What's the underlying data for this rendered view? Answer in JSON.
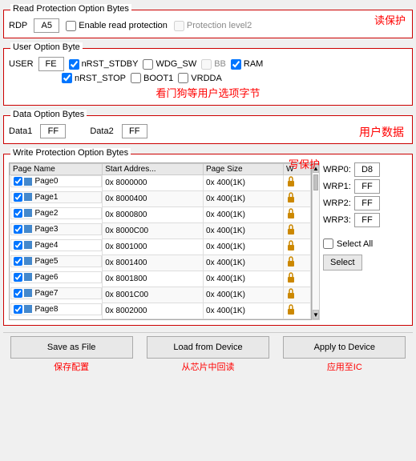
{
  "readProtection": {
    "title": "Read Protection Option Bytes",
    "annotation": "读保护",
    "rdpLabel": "RDP",
    "rdpValue": "A5",
    "enableReadProtection": "Enable read protection",
    "protectionLevel2": "Protection level2",
    "enableChecked": false,
    "level2Checked": false
  },
  "userOption": {
    "title": "User Option Byte",
    "annotation": "看门狗等用户选项字节",
    "userLabel": "USER",
    "userValue": "FE",
    "options": [
      {
        "label": "nRST_STDBY",
        "checked": true
      },
      {
        "label": "WDG_SW",
        "checked": false
      },
      {
        "label": "BB",
        "checked": false
      },
      {
        "label": "RAM",
        "checked": true
      }
    ],
    "row2Options": [
      {
        "label": "nRST_STOP",
        "checked": true
      },
      {
        "label": "BOOT1",
        "checked": false
      },
      {
        "label": "VRDDA",
        "checked": false
      }
    ]
  },
  "dataOption": {
    "title": "Data Option Bytes",
    "annotation": "用户数据",
    "data1Label": "Data1",
    "data1Value": "FF",
    "data2Label": "Data2",
    "data2Value": "FF"
  },
  "writeProtection": {
    "title": "Write Protection Option Bytes",
    "annotation": "写保护",
    "tableHeaders": [
      "Page Name",
      "Start Addres...",
      "Page Size",
      "W"
    ],
    "pages": [
      {
        "name": "Page0",
        "start": "0x 8000000",
        "size": "0x 400(1K)",
        "checked": true
      },
      {
        "name": "Page1",
        "start": "0x 8000400",
        "size": "0x 400(1K)",
        "checked": true
      },
      {
        "name": "Page2",
        "start": "0x 8000800",
        "size": "0x 400(1K)",
        "checked": true
      },
      {
        "name": "Page3",
        "start": "0x 8000C00",
        "size": "0x 400(1K)",
        "checked": true
      },
      {
        "name": "Page4",
        "start": "0x 8001000",
        "size": "0x 400(1K)",
        "checked": true
      },
      {
        "name": "Page5",
        "start": "0x 8001400",
        "size": "0x 400(1K)",
        "checked": true
      },
      {
        "name": "Page6",
        "start": "0x 8001800",
        "size": "0x 400(1K)",
        "checked": true
      },
      {
        "name": "Page7",
        "start": "0x 8001C00",
        "size": "0x 400(1K)",
        "checked": true
      },
      {
        "name": "Page8",
        "start": "0x 8002000",
        "size": "0x 400(1K)",
        "checked": true
      }
    ],
    "wrpLabels": [
      "WRP0:",
      "WRP1:",
      "WRP2:",
      "WRP3:"
    ],
    "wrpValues": [
      "D8",
      "FF",
      "FF",
      "FF"
    ],
    "selectAll": "Select All",
    "selectBtn": "Select"
  },
  "buttons": {
    "saveAsFile": "Save as File",
    "loadFromDevice": "Load from Device",
    "applyToDevice": "Apply to Device",
    "annotations": [
      "保存配置",
      "从芯片中回读",
      "应用至IC"
    ]
  }
}
